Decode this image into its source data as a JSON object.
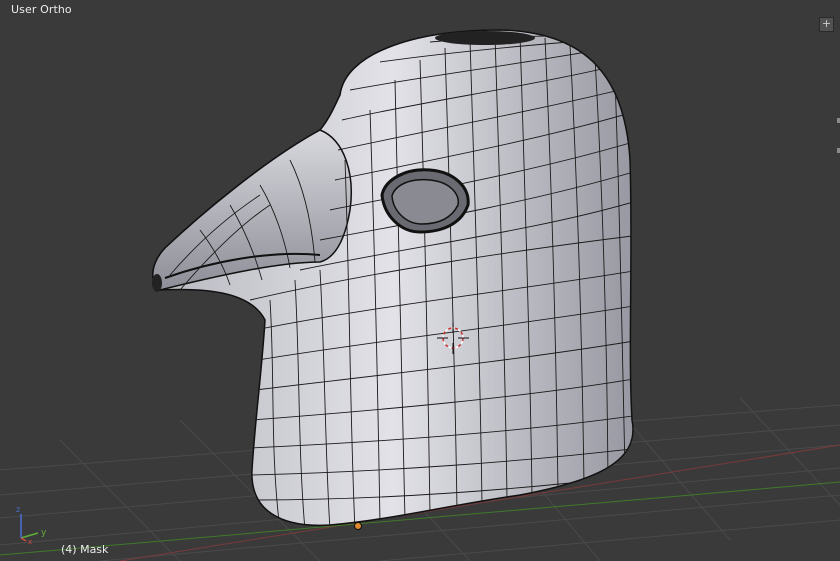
{
  "viewport": {
    "view_name": "User Ortho",
    "object_label": "(4) Mask",
    "corner_widget_glyph": "+"
  },
  "axis_gizmo": {
    "x_label": "x",
    "y_label": "y",
    "z_label": "z",
    "x_color": "#d44a4a",
    "y_color": "#5fae3a",
    "z_color": "#4a6fd4"
  },
  "colors": {
    "background": "#3a3a3a",
    "grid": "#4a4a4a",
    "mesh_fill": "#c9c9d0",
    "wire": "#1a1a1a",
    "origin_dot": "#e08a30",
    "cursor_red": "#c83030"
  }
}
